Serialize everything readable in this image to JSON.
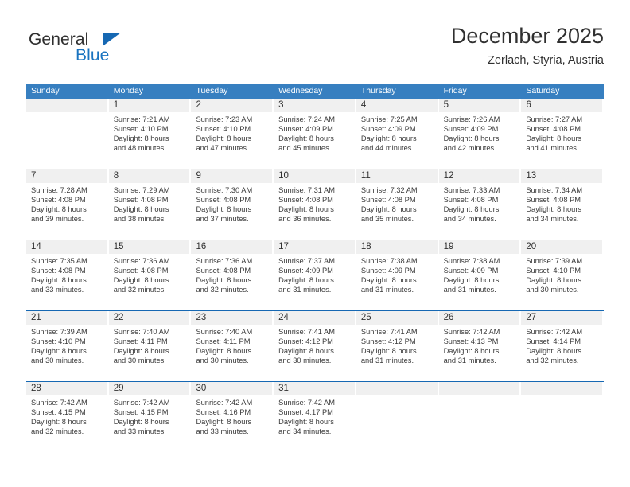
{
  "brand": {
    "name_part1": "General",
    "name_part2": "Blue",
    "triangle_color": "#1668b3",
    "blue_color": "#1a74c0"
  },
  "header": {
    "title": "December 2025",
    "subtitle": "Zerlach, Styria, Austria"
  },
  "calendar": {
    "header_color": "#377fc0",
    "separator_color": "#1668b3",
    "day_band_color": "#f0f0f0",
    "weekdays": [
      "Sunday",
      "Monday",
      "Tuesday",
      "Wednesday",
      "Thursday",
      "Friday",
      "Saturday"
    ],
    "weeks": [
      [
        {
          "day": "",
          "sunrise": "",
          "sunset": "",
          "daylight1": "",
          "daylight2": ""
        },
        {
          "day": "1",
          "sunrise": "Sunrise: 7:21 AM",
          "sunset": "Sunset: 4:10 PM",
          "daylight1": "Daylight: 8 hours",
          "daylight2": "and 48 minutes."
        },
        {
          "day": "2",
          "sunrise": "Sunrise: 7:23 AM",
          "sunset": "Sunset: 4:10 PM",
          "daylight1": "Daylight: 8 hours",
          "daylight2": "and 47 minutes."
        },
        {
          "day": "3",
          "sunrise": "Sunrise: 7:24 AM",
          "sunset": "Sunset: 4:09 PM",
          "daylight1": "Daylight: 8 hours",
          "daylight2": "and 45 minutes."
        },
        {
          "day": "4",
          "sunrise": "Sunrise: 7:25 AM",
          "sunset": "Sunset: 4:09 PM",
          "daylight1": "Daylight: 8 hours",
          "daylight2": "and 44 minutes."
        },
        {
          "day": "5",
          "sunrise": "Sunrise: 7:26 AM",
          "sunset": "Sunset: 4:09 PM",
          "daylight1": "Daylight: 8 hours",
          "daylight2": "and 42 minutes."
        },
        {
          "day": "6",
          "sunrise": "Sunrise: 7:27 AM",
          "sunset": "Sunset: 4:08 PM",
          "daylight1": "Daylight: 8 hours",
          "daylight2": "and 41 minutes."
        }
      ],
      [
        {
          "day": "7",
          "sunrise": "Sunrise: 7:28 AM",
          "sunset": "Sunset: 4:08 PM",
          "daylight1": "Daylight: 8 hours",
          "daylight2": "and 39 minutes."
        },
        {
          "day": "8",
          "sunrise": "Sunrise: 7:29 AM",
          "sunset": "Sunset: 4:08 PM",
          "daylight1": "Daylight: 8 hours",
          "daylight2": "and 38 minutes."
        },
        {
          "day": "9",
          "sunrise": "Sunrise: 7:30 AM",
          "sunset": "Sunset: 4:08 PM",
          "daylight1": "Daylight: 8 hours",
          "daylight2": "and 37 minutes."
        },
        {
          "day": "10",
          "sunrise": "Sunrise: 7:31 AM",
          "sunset": "Sunset: 4:08 PM",
          "daylight1": "Daylight: 8 hours",
          "daylight2": "and 36 minutes."
        },
        {
          "day": "11",
          "sunrise": "Sunrise: 7:32 AM",
          "sunset": "Sunset: 4:08 PM",
          "daylight1": "Daylight: 8 hours",
          "daylight2": "and 35 minutes."
        },
        {
          "day": "12",
          "sunrise": "Sunrise: 7:33 AM",
          "sunset": "Sunset: 4:08 PM",
          "daylight1": "Daylight: 8 hours",
          "daylight2": "and 34 minutes."
        },
        {
          "day": "13",
          "sunrise": "Sunrise: 7:34 AM",
          "sunset": "Sunset: 4:08 PM",
          "daylight1": "Daylight: 8 hours",
          "daylight2": "and 34 minutes."
        }
      ],
      [
        {
          "day": "14",
          "sunrise": "Sunrise: 7:35 AM",
          "sunset": "Sunset: 4:08 PM",
          "daylight1": "Daylight: 8 hours",
          "daylight2": "and 33 minutes."
        },
        {
          "day": "15",
          "sunrise": "Sunrise: 7:36 AM",
          "sunset": "Sunset: 4:08 PM",
          "daylight1": "Daylight: 8 hours",
          "daylight2": "and 32 minutes."
        },
        {
          "day": "16",
          "sunrise": "Sunrise: 7:36 AM",
          "sunset": "Sunset: 4:08 PM",
          "daylight1": "Daylight: 8 hours",
          "daylight2": "and 32 minutes."
        },
        {
          "day": "17",
          "sunrise": "Sunrise: 7:37 AM",
          "sunset": "Sunset: 4:09 PM",
          "daylight1": "Daylight: 8 hours",
          "daylight2": "and 31 minutes."
        },
        {
          "day": "18",
          "sunrise": "Sunrise: 7:38 AM",
          "sunset": "Sunset: 4:09 PM",
          "daylight1": "Daylight: 8 hours",
          "daylight2": "and 31 minutes."
        },
        {
          "day": "19",
          "sunrise": "Sunrise: 7:38 AM",
          "sunset": "Sunset: 4:09 PM",
          "daylight1": "Daylight: 8 hours",
          "daylight2": "and 31 minutes."
        },
        {
          "day": "20",
          "sunrise": "Sunrise: 7:39 AM",
          "sunset": "Sunset: 4:10 PM",
          "daylight1": "Daylight: 8 hours",
          "daylight2": "and 30 minutes."
        }
      ],
      [
        {
          "day": "21",
          "sunrise": "Sunrise: 7:39 AM",
          "sunset": "Sunset: 4:10 PM",
          "daylight1": "Daylight: 8 hours",
          "daylight2": "and 30 minutes."
        },
        {
          "day": "22",
          "sunrise": "Sunrise: 7:40 AM",
          "sunset": "Sunset: 4:11 PM",
          "daylight1": "Daylight: 8 hours",
          "daylight2": "and 30 minutes."
        },
        {
          "day": "23",
          "sunrise": "Sunrise: 7:40 AM",
          "sunset": "Sunset: 4:11 PM",
          "daylight1": "Daylight: 8 hours",
          "daylight2": "and 30 minutes."
        },
        {
          "day": "24",
          "sunrise": "Sunrise: 7:41 AM",
          "sunset": "Sunset: 4:12 PM",
          "daylight1": "Daylight: 8 hours",
          "daylight2": "and 30 minutes."
        },
        {
          "day": "25",
          "sunrise": "Sunrise: 7:41 AM",
          "sunset": "Sunset: 4:12 PM",
          "daylight1": "Daylight: 8 hours",
          "daylight2": "and 31 minutes."
        },
        {
          "day": "26",
          "sunrise": "Sunrise: 7:42 AM",
          "sunset": "Sunset: 4:13 PM",
          "daylight1": "Daylight: 8 hours",
          "daylight2": "and 31 minutes."
        },
        {
          "day": "27",
          "sunrise": "Sunrise: 7:42 AM",
          "sunset": "Sunset: 4:14 PM",
          "daylight1": "Daylight: 8 hours",
          "daylight2": "and 32 minutes."
        }
      ],
      [
        {
          "day": "28",
          "sunrise": "Sunrise: 7:42 AM",
          "sunset": "Sunset: 4:15 PM",
          "daylight1": "Daylight: 8 hours",
          "daylight2": "and 32 minutes."
        },
        {
          "day": "29",
          "sunrise": "Sunrise: 7:42 AM",
          "sunset": "Sunset: 4:15 PM",
          "daylight1": "Daylight: 8 hours",
          "daylight2": "and 33 minutes."
        },
        {
          "day": "30",
          "sunrise": "Sunrise: 7:42 AM",
          "sunset": "Sunset: 4:16 PM",
          "daylight1": "Daylight: 8 hours",
          "daylight2": "and 33 minutes."
        },
        {
          "day": "31",
          "sunrise": "Sunrise: 7:42 AM",
          "sunset": "Sunset: 4:17 PM",
          "daylight1": "Daylight: 8 hours",
          "daylight2": "and 34 minutes."
        },
        {
          "day": "",
          "sunrise": "",
          "sunset": "",
          "daylight1": "",
          "daylight2": ""
        },
        {
          "day": "",
          "sunrise": "",
          "sunset": "",
          "daylight1": "",
          "daylight2": ""
        },
        {
          "day": "",
          "sunrise": "",
          "sunset": "",
          "daylight1": "",
          "daylight2": ""
        }
      ]
    ]
  }
}
